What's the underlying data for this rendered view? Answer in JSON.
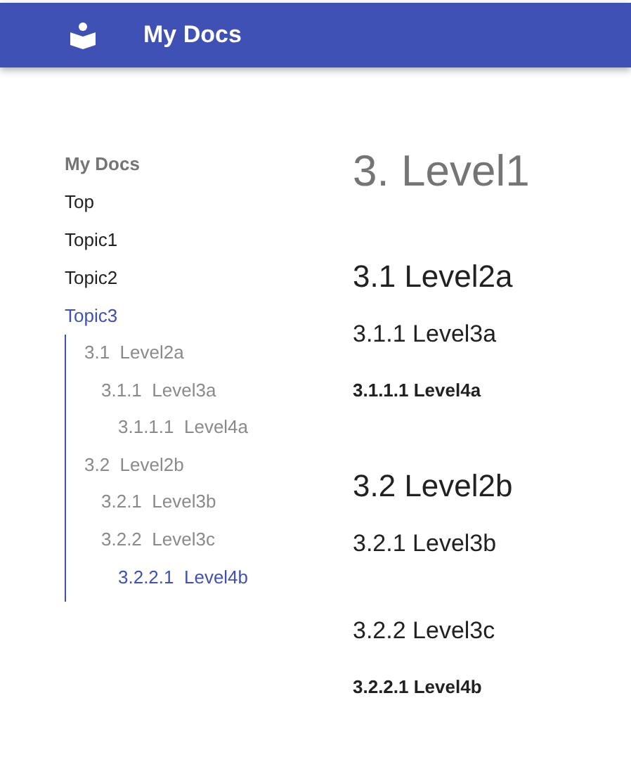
{
  "app_bar": {
    "title": "My Docs"
  },
  "nav": {
    "heading": "My Docs",
    "items": [
      {
        "label": "Top",
        "selected": false
      },
      {
        "label": "Topic1",
        "selected": false
      },
      {
        "label": "Topic2",
        "selected": false
      },
      {
        "label": "Topic3",
        "selected": true
      }
    ]
  },
  "toc": [
    {
      "number": "3.1",
      "title": "Level2a",
      "selected": false,
      "children": [
        {
          "number": "3.1.1",
          "title": "Level3a",
          "selected": false,
          "children": [
            {
              "number": "3.1.1.1",
              "title": "Level4a",
              "selected": false
            }
          ]
        }
      ]
    },
    {
      "number": "3.2",
      "title": "Level2b",
      "selected": false,
      "children": [
        {
          "number": "3.2.1",
          "title": "Level3b",
          "selected": false
        },
        {
          "number": "3.2.2",
          "title": "Level3c",
          "selected": false,
          "children": [
            {
              "number": "3.2.2.1",
              "title": "Level4b",
              "selected": true
            }
          ]
        }
      ]
    }
  ],
  "content": [
    {
      "kind": "h1",
      "text": "3. Level1"
    },
    {
      "kind": "h2",
      "text": "3.1 Level2a"
    },
    {
      "kind": "h3",
      "text": "3.1.1 Level3a"
    },
    {
      "kind": "h4",
      "text": "3.1.1.1 Level4a"
    },
    {
      "kind": "h2",
      "text": "3.2 Level2b"
    },
    {
      "kind": "h3",
      "text": "3.2.1 Level3b"
    },
    {
      "kind": "h3",
      "text": "3.2.2 Level3c"
    },
    {
      "kind": "h4",
      "text": "3.2.2.1 Level4b"
    }
  ]
}
